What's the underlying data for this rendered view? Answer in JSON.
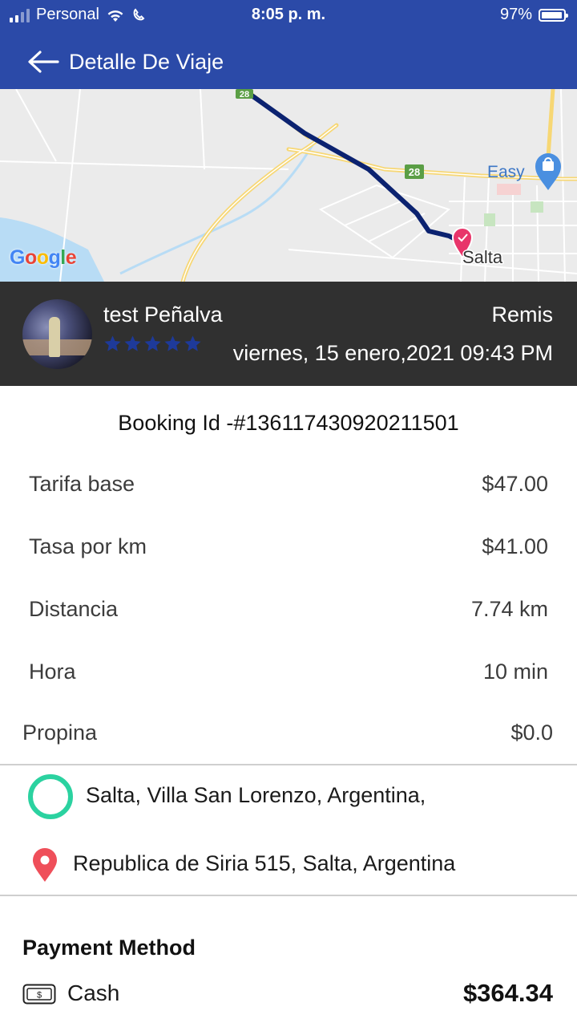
{
  "status_bar": {
    "carrier": "Personal",
    "time": "8:05 p. m.",
    "battery": "97%",
    "battery_level": 0.97
  },
  "header": {
    "title": "Detalle De Viaje",
    "back_icon": "arrow-left-icon"
  },
  "map": {
    "provider_logo": "Google",
    "labels": {
      "route_28_a": "28",
      "route_28_b": "28",
      "store": "Easy",
      "city": "Salta"
    },
    "route_color": "#0b2270"
  },
  "driver": {
    "name": "test Peñalva",
    "vehicle_type": "Remis",
    "datetime": "viernes, 15 enero,2021 09:43 PM",
    "rating": 5,
    "rating_max": 5,
    "star_color": "#1e3a9a"
  },
  "booking": {
    "id_label": "Booking Id -#136117430920211501"
  },
  "fare": [
    {
      "label": "Tarifa base",
      "value": "$47.00"
    },
    {
      "label": "Tasa por km",
      "value": "$41.00"
    },
    {
      "label": "Distancia",
      "value": "7.74 km"
    },
    {
      "label": "Hora",
      "value": "10 min"
    }
  ],
  "tip": {
    "label": "Propina",
    "value": "$0.0"
  },
  "locations": {
    "pickup": "Salta, Villa San Lorenzo, Argentina,",
    "dropoff": "Republica de Siria 515, Salta, Argentina",
    "pickup_color": "#2bd2a0",
    "dropoff_color": "#ef4f5a"
  },
  "payment": {
    "title": "Payment Method",
    "method": "Cash",
    "total": "$364.34"
  },
  "colors": {
    "header_bg": "#2b4aa8",
    "panel_bg": "#303030"
  }
}
